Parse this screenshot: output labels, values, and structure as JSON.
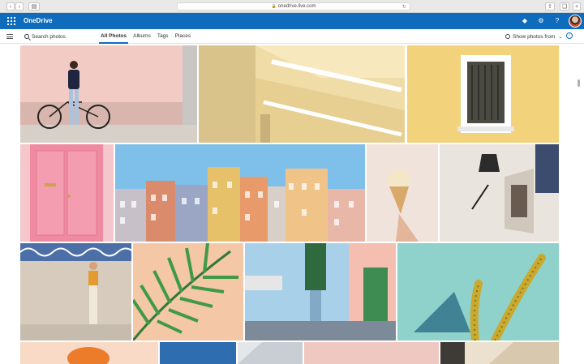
{
  "browser": {
    "url": "onedrive.live.com",
    "lock_icon": "lock-icon",
    "reload_icon": "reload-icon"
  },
  "header": {
    "brand": "OneDrive",
    "icons": [
      "app-launcher-icon",
      "diamond-icon",
      "settings-icon",
      "help-icon",
      "avatar"
    ]
  },
  "command_bar": {
    "search_placeholder": "Search photos",
    "tabs": [
      {
        "label": "All Photos",
        "active": true
      },
      {
        "label": "Albums",
        "active": false
      },
      {
        "label": "Tags",
        "active": false
      },
      {
        "label": "Places",
        "active": false
      }
    ],
    "show_photos_label": "Show photos from",
    "info_icon": "info-icon"
  },
  "colors": {
    "accent": "#0f6cbd",
    "header_bg": "#0f6cbd",
    "text": "#333333"
  }
}
